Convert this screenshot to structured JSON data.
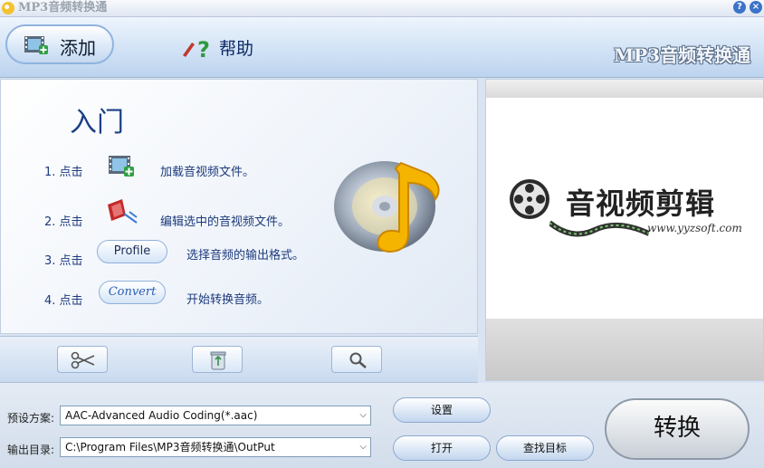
{
  "window": {
    "title": "MP3音频转换通"
  },
  "titlebar_buttons": {
    "help": "?",
    "close": "×"
  },
  "toolbar": {
    "add_label": "添加",
    "help_label": "帮助",
    "banner": "MP3音频转换通"
  },
  "guide": {
    "title": "入门",
    "steps": [
      {
        "num": "1. 点击",
        "text": "加载音视频文件。"
      },
      {
        "num": "2. 点击",
        "text": "编辑选中的音视频文件。"
      },
      {
        "num": "3. 点击",
        "button": "Profile",
        "text": "选择音频的输出格式。"
      },
      {
        "num": "4. 点击",
        "button": "Convert",
        "text": "开始转换音频。"
      }
    ]
  },
  "preview": {
    "brand_title": "音视频剪辑",
    "brand_url": "www.yyzsoft.com"
  },
  "settings": {
    "preset_label": "预设方案:",
    "preset_value": "AAC-Advanced Audio Coding(*.aac)",
    "output_label": "输出目录:",
    "output_value": "C:\\Program Files\\MP3音频转换通\\OutPut",
    "settings_button": "设置",
    "open_button": "打开",
    "find_button": "查找目标",
    "convert_button": "转换"
  },
  "icons": {
    "add": "film-add-icon",
    "help": "help-icon",
    "cut": "scissors-icon",
    "delete": "recycle-bin-icon",
    "search": "magnifier-icon",
    "music": "music-cd-icon",
    "reel": "film-reel-icon"
  }
}
